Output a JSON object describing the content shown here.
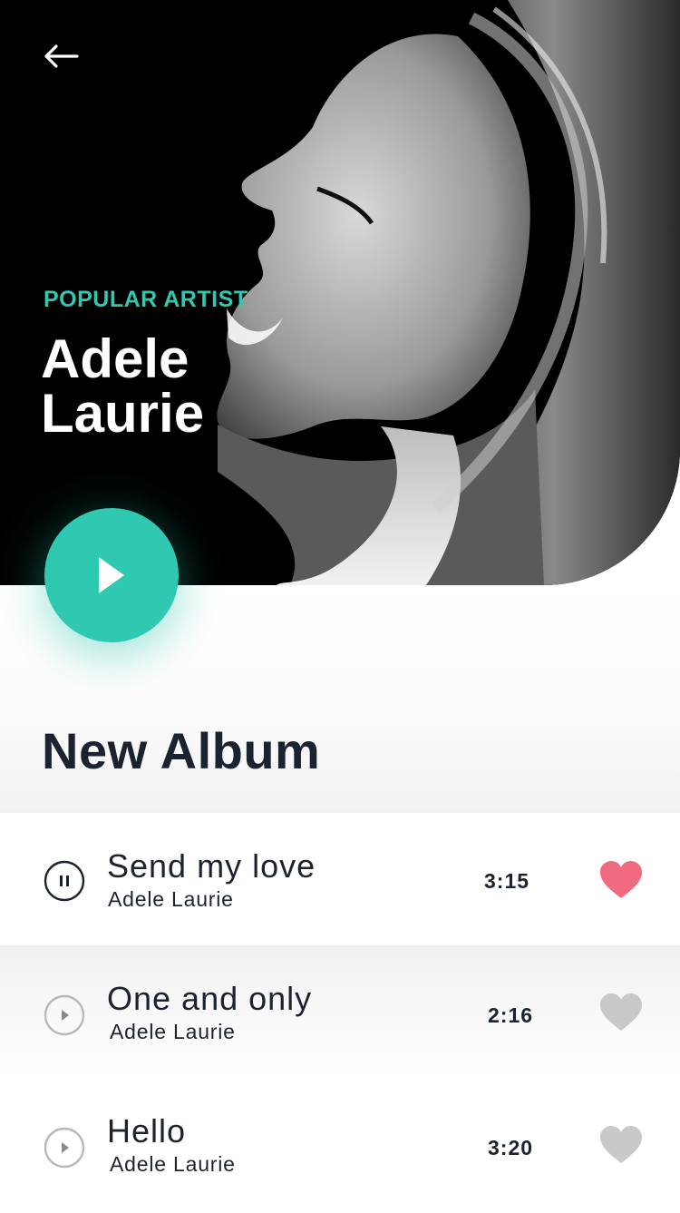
{
  "header": {
    "eyebrow": "POPULAR ARTIST",
    "artist_first": "Adele",
    "artist_last": "Laurie"
  },
  "icons": {
    "back": "arrow-left-icon",
    "play": "play-icon",
    "pause": "pause-icon",
    "heart": "heart-icon"
  },
  "colors": {
    "accent": "#2fc8b0",
    "liked": "#f26a7f",
    "unliked": "#c9c9c9",
    "text": "#1c2330"
  },
  "section": {
    "title": "New Album"
  },
  "tracks": [
    {
      "title": "Send my love",
      "artist": "Adele Laurie",
      "duration": "3:15",
      "state": "playing",
      "liked": true
    },
    {
      "title": "One and only",
      "artist": "Adele Laurie",
      "duration": "2:16",
      "state": "paused",
      "liked": false
    },
    {
      "title": "Hello",
      "artist": "Adele Laurie",
      "duration": "3:20",
      "state": "paused",
      "liked": false
    }
  ]
}
